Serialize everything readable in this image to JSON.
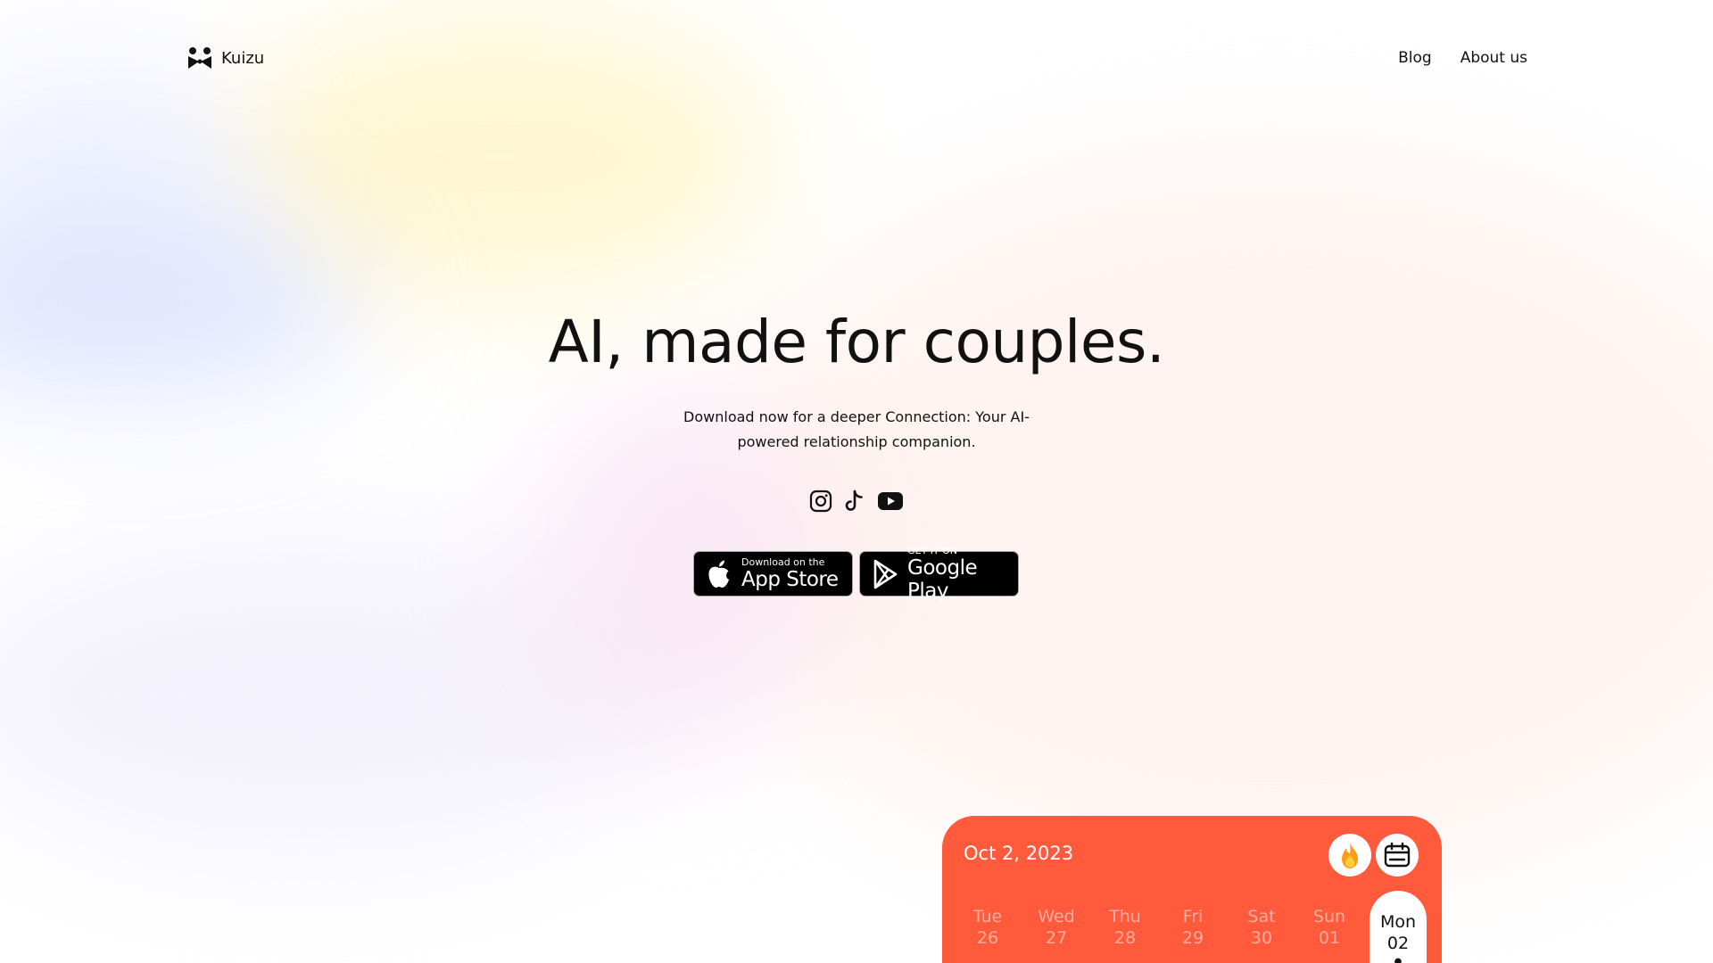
{
  "brand": {
    "name": "Kuizu",
    "icon": "bowtie-logo-icon"
  },
  "nav": {
    "links": [
      "Blog",
      "About us"
    ]
  },
  "hero": {
    "title": "AI, made for couples.",
    "subtitle": "Download now for a deeper Connection: Your AI-powered relationship companion."
  },
  "socials": [
    "instagram-icon",
    "tiktok-icon",
    "youtube-icon"
  ],
  "stores": {
    "apple": {
      "small": "Download on the",
      "big": "App Store",
      "icon": "apple-icon"
    },
    "google": {
      "small": "GET IT ON",
      "big": "Google Play",
      "icon": "google-play-icon"
    }
  },
  "card": {
    "date": "Oct 2, 2023",
    "actions": [
      "flame-icon",
      "calendar-icon"
    ],
    "days": [
      {
        "name": "Tue",
        "num": "26"
      },
      {
        "name": "Wed",
        "num": "27"
      },
      {
        "name": "Thu",
        "num": "28"
      },
      {
        "name": "Fri",
        "num": "29"
      },
      {
        "name": "Sat",
        "num": "30"
      },
      {
        "name": "Sun",
        "num": "01"
      },
      {
        "name": "Mon",
        "num": "02",
        "active": true
      }
    ]
  },
  "colors": {
    "accent": "#ff5a3c",
    "text": "#111111",
    "store_button": "#000000"
  }
}
